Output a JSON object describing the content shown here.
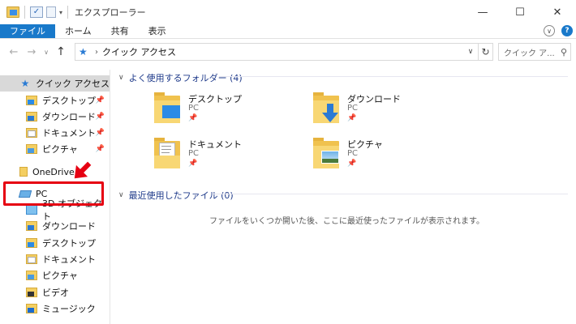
{
  "window": {
    "title": "エクスプローラー",
    "controls": [
      "—",
      "☐",
      "✕"
    ]
  },
  "ribbon": {
    "tabs": [
      "ファイル",
      "ホーム",
      "共有",
      "表示"
    ]
  },
  "address": {
    "path": "クイック アクセス",
    "search_placeholder": "クイック ア..."
  },
  "nav": {
    "items": [
      {
        "label": "クイック アクセス",
        "icon": "star-icon",
        "pinned": false,
        "selected": true
      },
      {
        "label": "デスクトップ",
        "icon": "desktop-folder-icon",
        "pinned": true
      },
      {
        "label": "ダウンロード",
        "icon": "downloads-folder-icon",
        "pinned": true
      },
      {
        "label": "ドキュメント",
        "icon": "documents-folder-icon",
        "pinned": true
      },
      {
        "label": "ピクチャ",
        "icon": "pictures-folder-icon",
        "pinned": true
      },
      {
        "label": "OneDrive",
        "icon": "onedrive-icon",
        "pinned": false
      },
      {
        "label": "PC",
        "icon": "pc-icon",
        "pinned": false
      },
      {
        "label": "3D オブジェクト",
        "icon": "3d-objects-icon",
        "pinned": false
      },
      {
        "label": "ダウンロード",
        "icon": "downloads-folder-icon",
        "pinned": false
      },
      {
        "label": "デスクトップ",
        "icon": "desktop-folder-icon",
        "pinned": false
      },
      {
        "label": "ドキュメント",
        "icon": "documents-folder-icon",
        "pinned": false
      },
      {
        "label": "ピクチャ",
        "icon": "pictures-folder-icon",
        "pinned": false
      },
      {
        "label": "ビデオ",
        "icon": "videos-folder-icon",
        "pinned": false
      },
      {
        "label": "ミュージック",
        "icon": "music-folder-icon",
        "pinned": false
      }
    ]
  },
  "main": {
    "frequent_header": "よく使用するフォルダー (4)",
    "frequent": [
      {
        "name": "デスクトップ",
        "location": "PC",
        "icon": "desktop-folder-icon"
      },
      {
        "name": "ダウンロード",
        "location": "PC",
        "icon": "downloads-folder-icon"
      },
      {
        "name": "ドキュメント",
        "location": "PC",
        "icon": "documents-folder-icon"
      },
      {
        "name": "ピクチャ",
        "location": "PC",
        "icon": "pictures-folder-icon"
      }
    ],
    "recent_header": "最近使用したファイル (0)",
    "recent_empty": "ファイルをいくつか開いた後、ここに最近使ったファイルが表示されます。"
  },
  "colors": {
    "accent": "#1979ca",
    "highlight": "#e60012"
  }
}
